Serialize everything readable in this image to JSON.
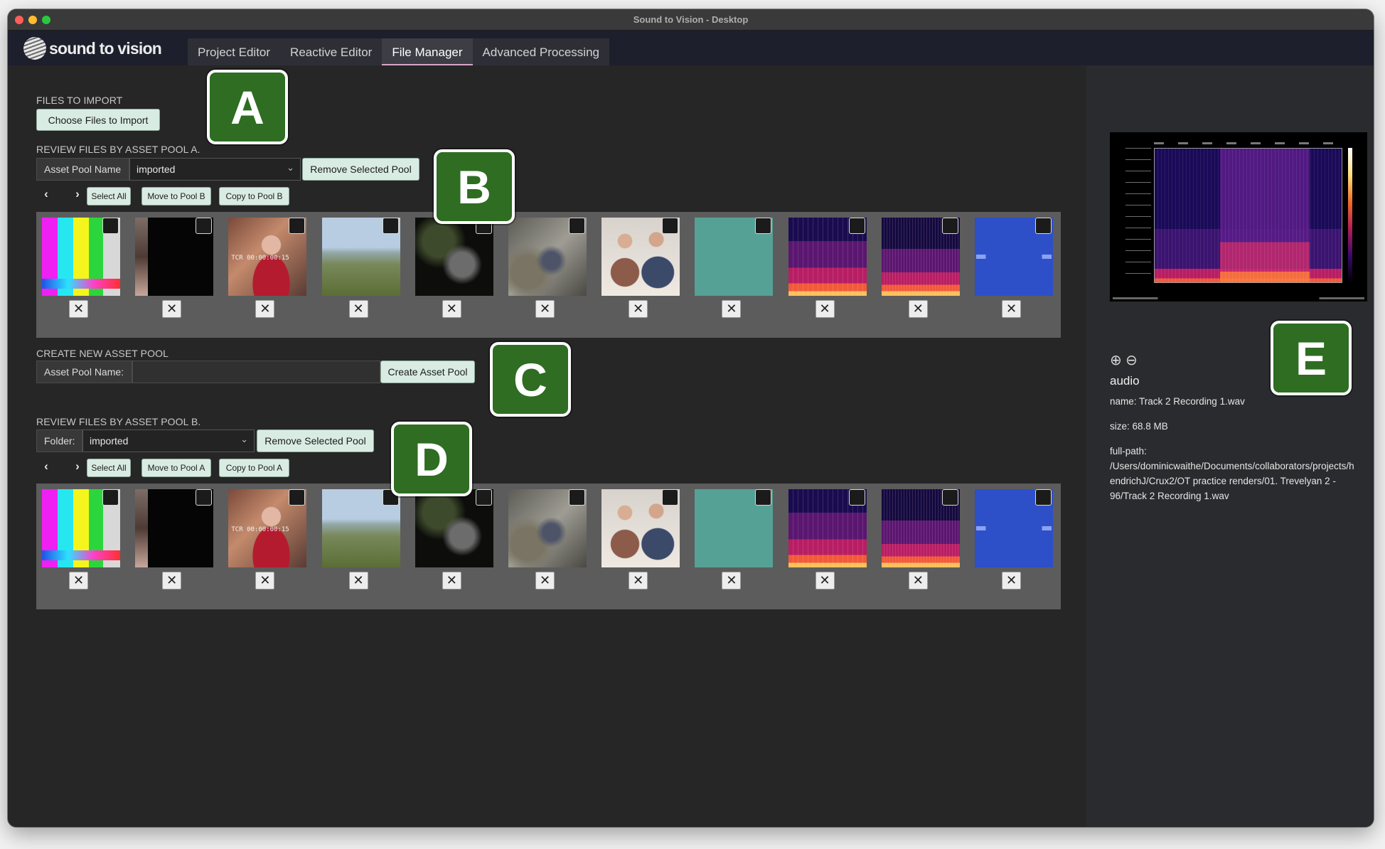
{
  "window": {
    "title": "Sound to Vision - Desktop"
  },
  "app": {
    "logo_text": "sound to vision"
  },
  "tabs": [
    {
      "label": "Project Editor"
    },
    {
      "label": "Reactive Editor"
    },
    {
      "label": "File Manager",
      "active": true
    },
    {
      "label": "Advanced Processing"
    }
  ],
  "import_section": {
    "heading": "FILES TO IMPORT",
    "choose_button": "Choose Files to Import"
  },
  "pool_a": {
    "heading": "REVIEW FILES BY ASSET POOL A.",
    "name_label": "Asset Pool Name",
    "selected_pool": "imported",
    "remove_button": "Remove Selected Pool",
    "prev_icon": "‹",
    "next_icon": "›",
    "select_all": "Select All",
    "move_button": "Move to Pool B",
    "copy_button": "Copy to Pool B"
  },
  "create_pool": {
    "heading": "CREATE NEW ASSET POOL",
    "name_label": "Asset Pool Name:",
    "name_value": "",
    "create_button": "Create Asset Pool"
  },
  "pool_b": {
    "heading": "REVIEW FILES BY ASSET POOL B.",
    "name_label": "Folder:",
    "selected_pool": "imported",
    "remove_button": "Remove Selected Pool",
    "prev_icon": "‹",
    "next_icon": "›",
    "select_all": "Select All",
    "move_button": "Move to Pool A",
    "copy_button": "Copy to Pool A"
  },
  "thumbnails": [
    {
      "kind": "color-bars",
      "style": "th-bars"
    },
    {
      "kind": "black-frame",
      "style": "th-black"
    },
    {
      "kind": "woman-video",
      "style": "th-woman",
      "timecode": "TCR 00:00:00:15"
    },
    {
      "kind": "landscape",
      "style": "th-landscape"
    },
    {
      "kind": "dark-scene",
      "style": "th-dark"
    },
    {
      "kind": "rocks",
      "style": "th-rocks"
    },
    {
      "kind": "office-meeting",
      "style": "th-office"
    },
    {
      "kind": "teal-solid",
      "style": "th-teal"
    },
    {
      "kind": "spectrogram",
      "style": "th-spec"
    },
    {
      "kind": "spectrogram",
      "style": "th-spec2"
    },
    {
      "kind": "waveform",
      "style": "th-wave"
    }
  ],
  "remove_icon": "✕",
  "callouts": [
    "A",
    "B",
    "C",
    "D",
    "E"
  ],
  "preview": {
    "zoom_in_icon": "⊕",
    "zoom_out_icon": "⊖",
    "type": "audio",
    "name": "name: Track 2 Recording 1.wav",
    "size": "size: 68.8 MB",
    "path_label": "full-path:",
    "path_lines": [
      "/Users/dominicwaithe/Documents/collaborators/projects/h",
      "endrichJ/Crux2/OT practice renders/01. Trevelyan 2 -",
      "96/Track 2 Recording 1.wav"
    ]
  },
  "colors": {
    "callout_bg": "#2e6d22",
    "button_bg": "#d9ece3",
    "active_tab_underline": "#d7a6c8",
    "app_bar": "#1d1f2c"
  }
}
